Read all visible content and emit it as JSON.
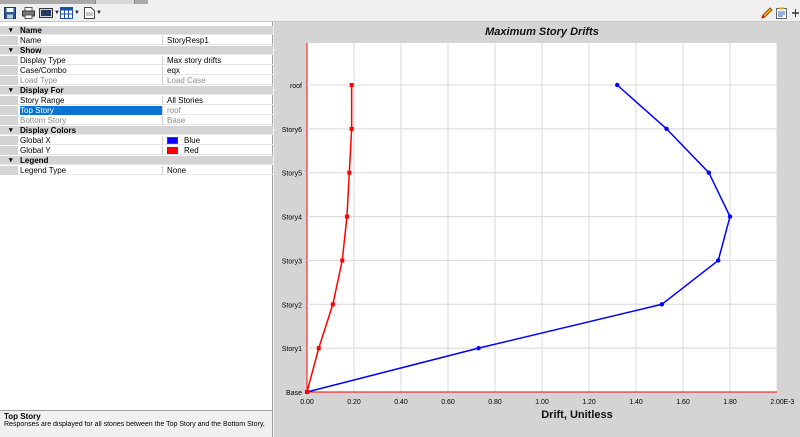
{
  "toolbar": {
    "icons": [
      "save-icon",
      "print-icon",
      "export-icon",
      "table-icon",
      "document-icon",
      "pencil-icon",
      "clipboard-icon",
      "pin-icon"
    ]
  },
  "properties": {
    "rows": [
      {
        "type": "category",
        "label": "Name"
      },
      {
        "type": "item",
        "key": "Name",
        "value": "StoryResp1"
      },
      {
        "type": "category",
        "label": "Show"
      },
      {
        "type": "item",
        "key": "Display Type",
        "value": "Max story drifts"
      },
      {
        "type": "item",
        "key": "Case/Combo",
        "value": "eqx"
      },
      {
        "type": "item",
        "key": "Load Type",
        "value": "Load Case",
        "dim": true
      },
      {
        "type": "category",
        "label": "Display For"
      },
      {
        "type": "item",
        "key": "Story Range",
        "value": "All Stories"
      },
      {
        "type": "item",
        "key": "Top Story",
        "value": "roof",
        "selected": true
      },
      {
        "type": "item",
        "key": "Bottom Story",
        "value": "Base",
        "dim": true
      },
      {
        "type": "category",
        "label": "Display Colors"
      },
      {
        "type": "item",
        "key": "Global X",
        "value": "Blue",
        "swatch": "#0000ff"
      },
      {
        "type": "item",
        "key": "Global Y",
        "value": "Red",
        "swatch": "#ff0000"
      },
      {
        "type": "category",
        "label": "Legend"
      },
      {
        "type": "item",
        "key": "Legend Type",
        "value": "None"
      }
    ]
  },
  "description": {
    "title": "Top Story",
    "text": "Responses are displayed for all stories between the Top Story and the Bottom Story, inclusive."
  },
  "chart_data": {
    "type": "line",
    "title": "Maximum Story Drifts",
    "xlabel": "Drift, Unitless",
    "x_multiplier_label": "E-3",
    "xlim": [
      0,
      2.0
    ],
    "x_ticks": [
      "0.00",
      "0.20",
      "0.40",
      "0.60",
      "0.80",
      "1.00",
      "1.20",
      "1.40",
      "1.60",
      "1.80",
      "2.00"
    ],
    "categories": [
      "Base",
      "Story1",
      "Story2",
      "Story3",
      "Story4",
      "Story5",
      "Story6",
      "roof"
    ],
    "grid": true,
    "series": [
      {
        "color": "#0000ff",
        "values": [
          0.0,
          0.73,
          1.51,
          1.75,
          1.8,
          1.71,
          1.53,
          1.32
        ]
      },
      {
        "color": "#ff0000",
        "values": [
          0.0,
          0.05,
          0.11,
          0.15,
          0.17,
          0.18,
          0.19,
          0.19
        ]
      }
    ]
  }
}
